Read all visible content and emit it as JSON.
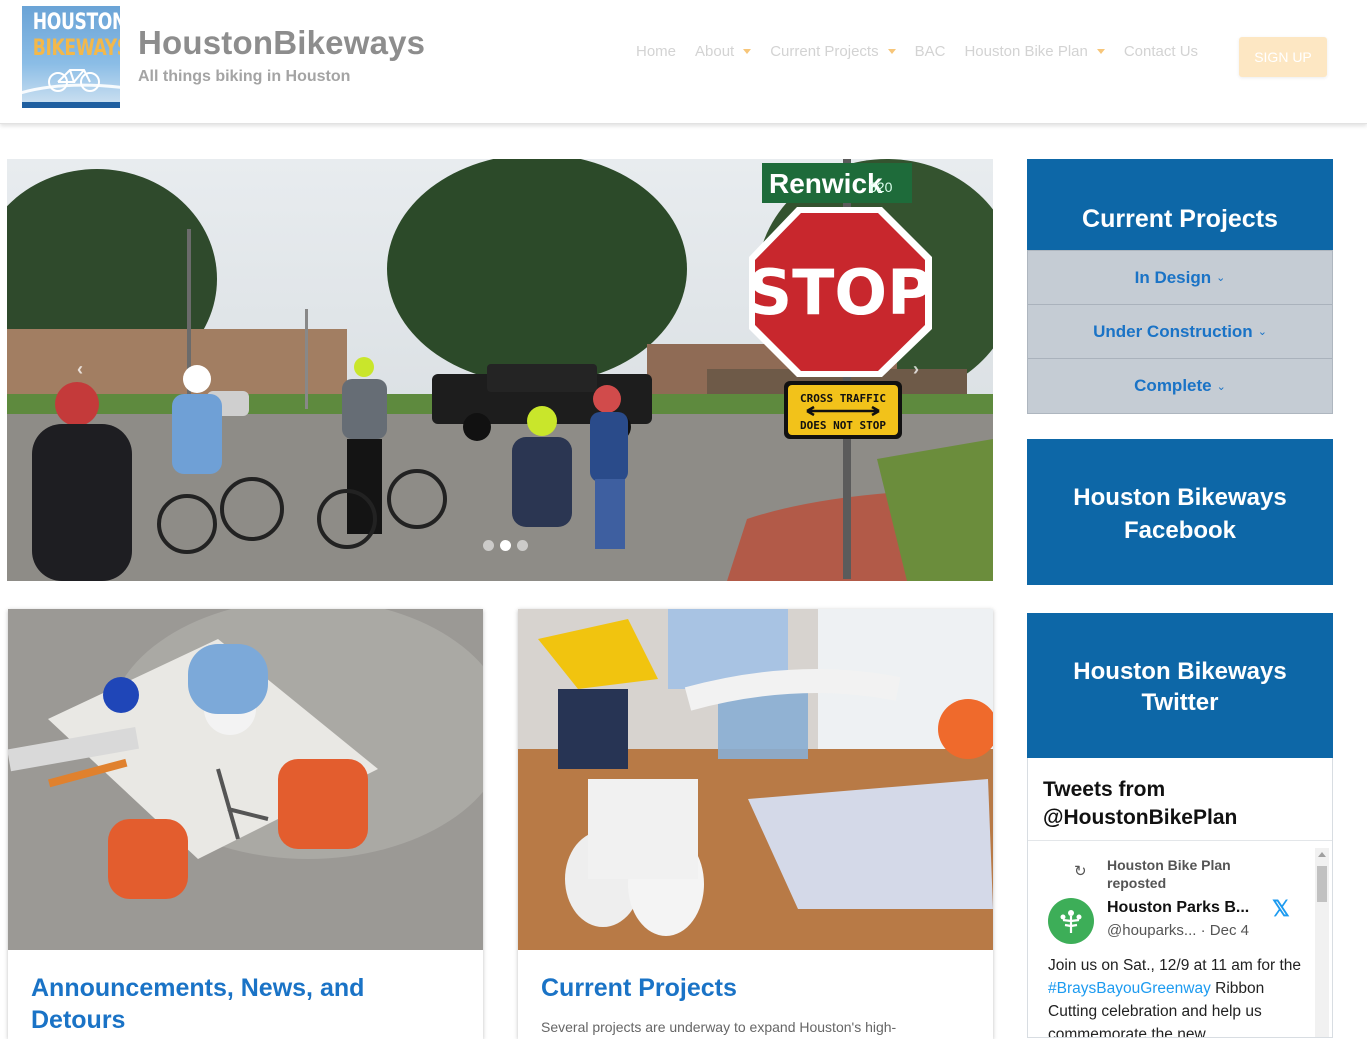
{
  "header": {
    "logo_line1": "HOUSTON",
    "logo_line2": "BIKEWAYS",
    "site_title": "HoustonBikeways",
    "tagline": "All things biking in Houston",
    "nav": [
      {
        "label": "Home",
        "has_dropdown": false
      },
      {
        "label": "About",
        "has_dropdown": true
      },
      {
        "label": "Current Projects",
        "has_dropdown": true
      },
      {
        "label": "BAC",
        "has_dropdown": false
      },
      {
        "label": "Houston Bike Plan",
        "has_dropdown": true
      },
      {
        "label": "Contact Us",
        "has_dropdown": false
      }
    ],
    "signup_label": "SIGN UP"
  },
  "hero": {
    "street_sign": "Renwick",
    "street_sign_number": "620",
    "stop_sign": "STOP",
    "warning_line1": "CROSS TRAFFIC",
    "warning_line2": "DOES NOT STOP",
    "prev_glyph": "‹",
    "next_glyph": "›",
    "slide_count": 3,
    "active_slide": 2
  },
  "cards": [
    {
      "title": "Announcements, News, and Detours",
      "text": ""
    },
    {
      "title": "Current Projects",
      "text": "Several projects are underway to expand Houston's high-"
    }
  ],
  "sidebar": {
    "current_projects_title": "Current Projects",
    "project_links": [
      "In Design",
      "Under Construction",
      "Complete"
    ],
    "facebook_label": "Houston Bikeways Facebook",
    "twitter_label": "Houston Bikeways Twitter",
    "tweets": {
      "header": "Tweets from @HoustonBikePlan",
      "reposter": "Houston Bike Plan reposted",
      "author_name": "Houston Parks B...",
      "author_handle": "@houparks...",
      "date": "Dec 4",
      "body_before": "Join us on Sat., 12/9 at 11 am for the ",
      "hashtag": "#BraysBayouGreenway",
      "body_after": " Ribbon Cutting celebration and help us commemorate the new"
    }
  },
  "colors": {
    "brand_blue": "#0d67a7",
    "link_blue": "#1a73c6",
    "nav_text": "#d3d3d3",
    "signup_bg": "#fde7c3",
    "twitter_blue": "#1d9bf0"
  }
}
